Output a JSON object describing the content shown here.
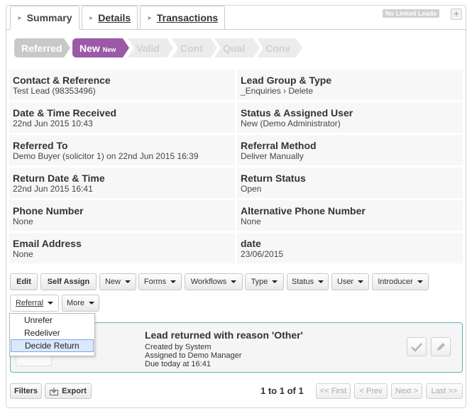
{
  "tabs": [
    {
      "label": "Summary",
      "active": true
    },
    {
      "label": "Details",
      "active": false
    },
    {
      "label": "Transactions",
      "active": false
    }
  ],
  "linked_leads_badge": "No Linked Leads",
  "add_symbol": "+",
  "stages": [
    {
      "label": "Referred",
      "sub": "",
      "color": "#c8c8c8"
    },
    {
      "label": "New",
      "sub": "New",
      "color": "#9b5aa8"
    },
    {
      "label": "Valid",
      "sub": "",
      "color": "#ececec"
    },
    {
      "label": "Cont",
      "sub": "",
      "color": "#ececec"
    },
    {
      "label": "Qual",
      "sub": "",
      "color": "#ececec"
    },
    {
      "label": "Conv",
      "sub": "",
      "color": "#ececec"
    }
  ],
  "fields": [
    [
      {
        "label": "Contact & Reference",
        "value": "Test Lead (98353496)"
      },
      {
        "label": "Lead Group & Type",
        "value": "_Enquiries › Delete"
      }
    ],
    [
      {
        "label": "Date & Time Received",
        "value": "22nd Jun 2015 10:43"
      },
      {
        "label": "Status & Assigned User",
        "value": "New (Demo Administrator)"
      }
    ],
    [
      {
        "label": "Referred To",
        "value": "Demo Buyer (solicitor 1) on 22nd Jun 2015 16:39"
      },
      {
        "label": "Referral Method",
        "value": "Deliver Manually"
      }
    ],
    [
      {
        "label": "Return Date & Time",
        "value": "22nd Jun 2015 16:41"
      },
      {
        "label": "Return Status",
        "value": "Open"
      }
    ],
    [
      {
        "label": "Phone Number",
        "value": "None"
      },
      {
        "label": "Alternative Phone Number",
        "value": "None"
      }
    ],
    [
      {
        "label": "Email Address",
        "value": "None"
      },
      {
        "label": "date",
        "value": "23/06/2015"
      }
    ]
  ],
  "toolbar": {
    "edit": "Edit",
    "self_assign": "Self Assign",
    "new": "New",
    "forms": "Forms",
    "workflows": "Workflows",
    "type": "Type",
    "status": "Status",
    "user": "User",
    "introducer": "Introducer",
    "referral": "Referral",
    "more": "More"
  },
  "referral_menu": [
    "Unrefer",
    "Redeliver",
    "Decide Return"
  ],
  "activity": {
    "title": "Lead returned with reason 'Other'",
    "created": "Created by System",
    "assigned": "Assigned to Demo Manager",
    "due": "Due today at 16:41"
  },
  "footer": {
    "filters": "Filters",
    "export": "Export",
    "pager": "1 to 1 of 1",
    "first": "<< First",
    "prev": "< Prev",
    "next": "Next >",
    "last": "Last >>"
  },
  "colors": {
    "accent_border": "#5fb7b3",
    "stage_new": "#9b5aa8",
    "menu_highlight": "#d9e8fb"
  }
}
